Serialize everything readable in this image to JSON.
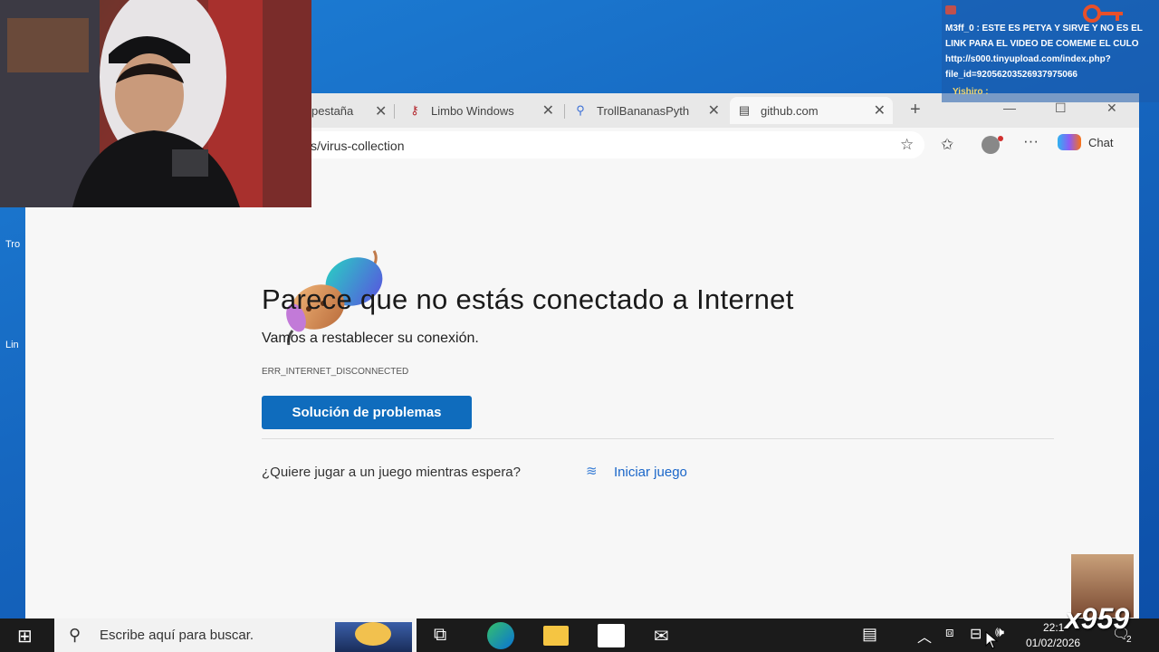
{
  "desktop": {
    "labels": [
      "Tro",
      "Lin"
    ]
  },
  "browser": {
    "tabs": [
      {
        "label": "pestaña",
        "icon": "tab-icon"
      },
      {
        "label": "Limbo Windows",
        "icon": "key-icon"
      },
      {
        "label": "TrollBananasPyth",
        "icon": "search-icon"
      },
      {
        "label": "github.com",
        "icon": "page-icon"
      }
    ],
    "address": "cs/virus-collection",
    "chat_label": "Chat",
    "error": {
      "title": "Parece que no estás conectado a Internet",
      "subtitle": "Vamos a restablecer su conexión.",
      "code": "ERR_INTERNET_DISCONNECTED",
      "button": "Solución de problemas",
      "game_question": "¿Quiere jugar a un juego mientras espera?",
      "game_link": "Iniciar juego"
    }
  },
  "chat_overlay": {
    "line1": "M3ff_0 : ESTE ES PETYA Y SIRVE Y NO ES EL",
    "line2": "LINK PARA EL VIDEO DE COMEME EL CULO",
    "line3": "http://s000.tinyupload.com/index.php?",
    "line4": "file_id=92056203526937975066",
    "line5": "Yishiro :"
  },
  "taskbar": {
    "search_placeholder": "Escribe aquí para buscar.",
    "time": "22:1",
    "date": "01/02/2026",
    "notif_count": "2"
  },
  "watermark": "x959",
  "colors": {
    "accent": "#0f6cbd",
    "link": "#1a66c9",
    "desktop": "#1667c0",
    "taskbar": "#1b1b1b"
  }
}
